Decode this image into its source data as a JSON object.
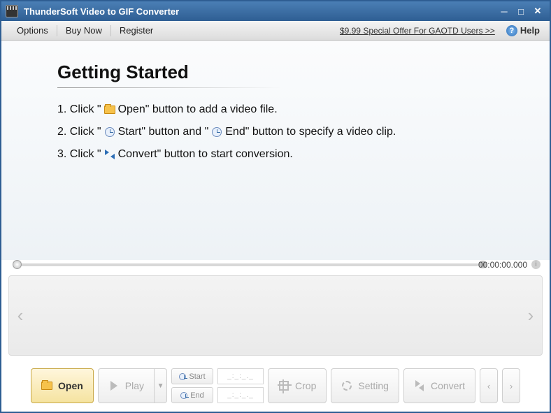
{
  "window": {
    "title": "ThunderSoft Video to GIF Converter"
  },
  "menu": {
    "options": "Options",
    "buynow": "Buy Now",
    "register": "Register",
    "special": "$9.99 Special Offer For GAOTD Users >>",
    "help": "Help"
  },
  "content": {
    "heading": "Getting Started",
    "step1_pre": "1. Click \"",
    "step1_mid": " Open\" button to add a video file.",
    "step2_pre": "2. Click \"",
    "step2_mid": " Start\" button and \"",
    "step2_end": " End\" button to specify a video clip.",
    "step3_pre": "3. Click \"",
    "step3_mid": " Convert\" button to start conversion."
  },
  "timeline": {
    "timecode": "00:00:00.000"
  },
  "toolbar": {
    "open": "Open",
    "play": "Play",
    "start": "Start",
    "end": "End",
    "time_placeholder": "_:_:_._",
    "crop": "Crop",
    "setting": "Setting",
    "convert": "Convert"
  }
}
